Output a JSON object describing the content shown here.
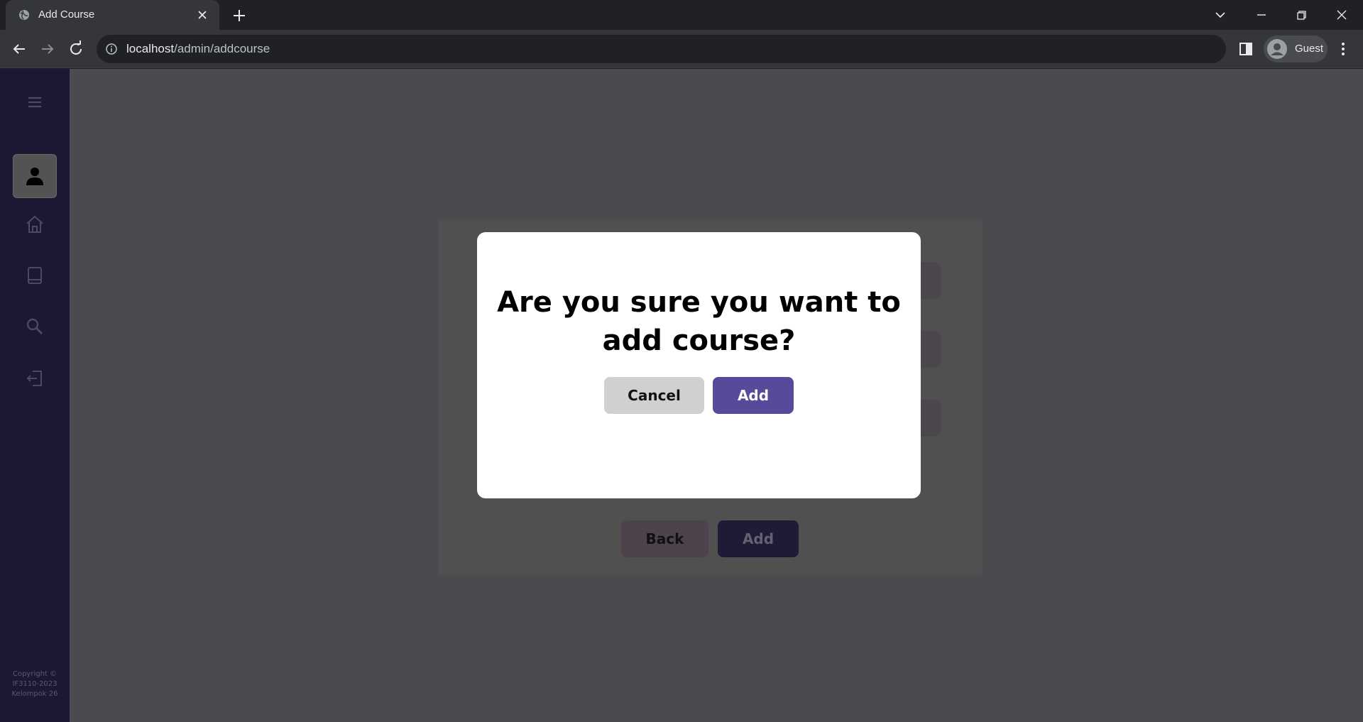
{
  "browser": {
    "tab_title": "Add Course",
    "url_host": "localhost",
    "url_path": "/admin/addcourse",
    "profile_name": "Guest"
  },
  "sidebar": {
    "items": [
      {
        "icon": "menu-icon"
      },
      {
        "icon": "user-icon",
        "active": true
      },
      {
        "icon": "home-icon"
      },
      {
        "icon": "book-icon"
      },
      {
        "icon": "search-icon"
      },
      {
        "icon": "logout-icon"
      }
    ],
    "copyright": "Copyright © IF3110-2023 Kelompok 26"
  },
  "form": {
    "back_label": "Back",
    "add_label": "Add"
  },
  "modal": {
    "message": "Are you sure you want to add course?",
    "cancel_label": "Cancel",
    "confirm_label": "Add"
  },
  "colors": {
    "sidebar_bg": "#1c1733",
    "overlay_bg": "#4c4a4f",
    "modal_bg": "#ffffff",
    "confirm_button": "#564a9b",
    "cancel_button": "#d0d0d0"
  }
}
